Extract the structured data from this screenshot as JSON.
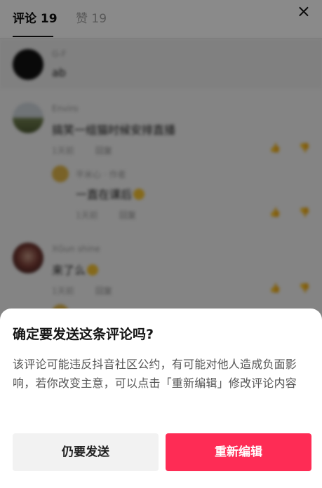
{
  "tabs": {
    "comments": "评论 19",
    "likes": "赞 19",
    "close": "×"
  },
  "comments": [
    {
      "name": "G-F",
      "text": "ab",
      "meta": "",
      "reply": ""
    },
    {
      "name": "Enviro",
      "text": "搞笑一组猫时候安排直播",
      "meta": "1天前",
      "reply": "回复"
    },
    {
      "name": "平米心 · 作者",
      "text": "一直在课后",
      "meta": "1天前",
      "reply": "回复"
    },
    {
      "name": "XGun shine",
      "text": "来了么",
      "meta": "1天前",
      "reply": "回复"
    }
  ],
  "dialog": {
    "title": "确定要发送这条评论吗?",
    "body": "该评论可能违反抖音社区公约，有可能对他人造成负面影响，若你改变主意，可以点击「重新编辑」修改评论内容",
    "send_anyway": "仍要发送",
    "re_edit": "重新编辑"
  },
  "colors": {
    "accent": "#fe2c55",
    "secondary_button": "#f2f2f2"
  }
}
